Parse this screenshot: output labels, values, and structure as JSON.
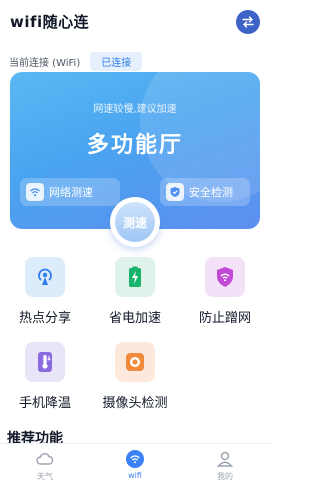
{
  "header": {
    "title": "wifi随心连"
  },
  "connection": {
    "label": "当前连接 (WiFi)",
    "status": "已连接"
  },
  "hero": {
    "subtitle": "网速较慢,建议加速",
    "title": "多功能厅",
    "left_chip": "网络测速",
    "right_chip": "安全检测",
    "test_button": "测速"
  },
  "tools": [
    {
      "label": "热点分享",
      "icon": "hotspot-icon"
    },
    {
      "label": "省电加速",
      "icon": "battery-icon"
    },
    {
      "label": "防止蹭网",
      "icon": "wifi-shield-icon"
    },
    {
      "label": "手机降温",
      "icon": "thermometer-icon"
    },
    {
      "label": "摄像头检测",
      "icon": "camera-icon"
    }
  ],
  "section": {
    "title": "推荐功能"
  },
  "tabbar": [
    {
      "label": "天气",
      "icon": "cloud-icon"
    },
    {
      "label": "wifi",
      "icon": "wifi-icon"
    },
    {
      "label": "我的",
      "icon": "user-icon"
    }
  ],
  "colors": {
    "accent": "#3b82f6",
    "hero": "#4aa3f0",
    "badge_text": "#2b7be5"
  }
}
